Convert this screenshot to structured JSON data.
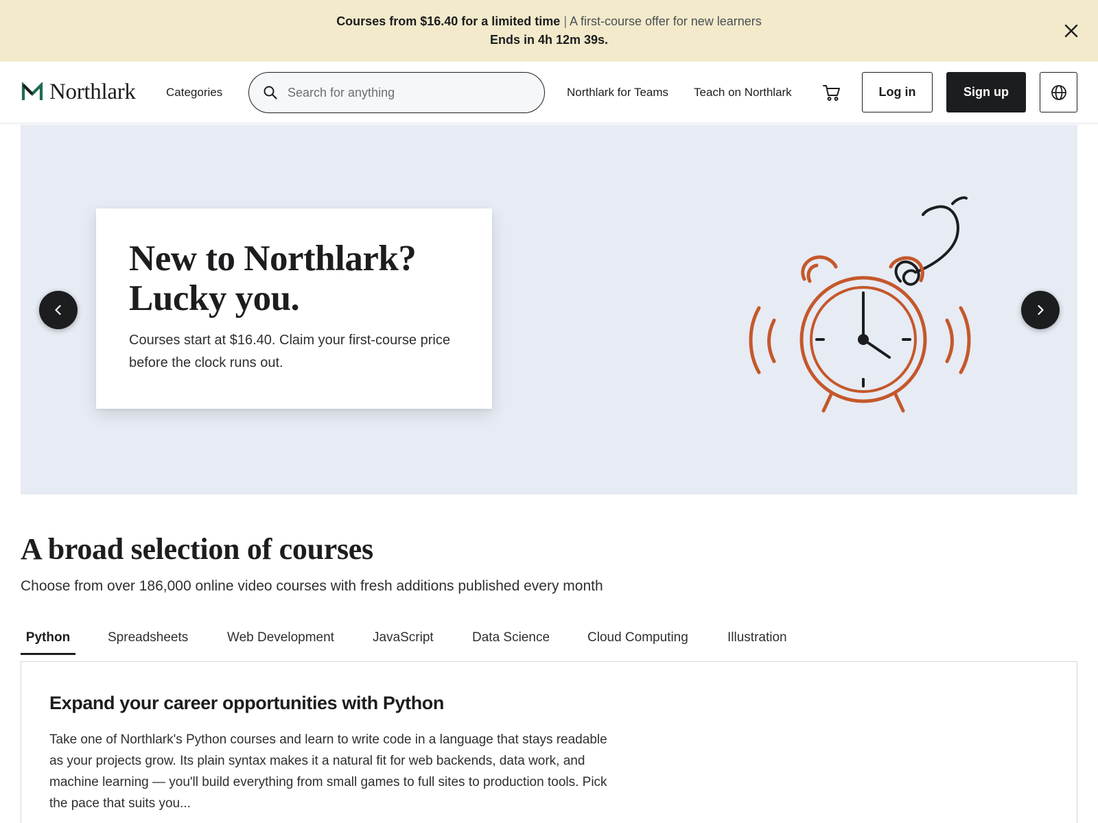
{
  "promo": {
    "headline": "Courses from $16.40 for a limited time",
    "separator": "|",
    "subtext": "A first-course offer for new learners",
    "countdown": "Ends in 4h 12m 39s.",
    "close_icon": "close-icon"
  },
  "header": {
    "logo_text": "Northlark",
    "categories_label": "Categories",
    "search": {
      "placeholder": "Search for anything",
      "value": ""
    },
    "teams_label": "Northlark for Teams",
    "teach_label": "Teach on Northlark",
    "cart_icon": "cart-icon",
    "login_label": "Log in",
    "signup_label": "Sign up",
    "language_icon": "globe-icon"
  },
  "hero": {
    "title_line1": "New to Northlark?",
    "title_line2": "Lucky you.",
    "text": "Courses start at $16.40. Claim your first-course price before the clock runs out.",
    "prev_icon": "chevron-left-icon",
    "next_icon": "chevron-right-icon",
    "illustration": "alarm-clock-illustration",
    "accent_color": "#c4582b",
    "background_color": "#e7ebf4"
  },
  "courses_section": {
    "title": "A broad selection of courses",
    "subtitle": "Choose from over 186,000 online video courses with fresh additions published every month",
    "tabs": [
      {
        "label": "Python",
        "active": true
      },
      {
        "label": "Spreadsheets",
        "active": false
      },
      {
        "label": "Web Development",
        "active": false
      },
      {
        "label": "JavaScript",
        "active": false
      },
      {
        "label": "Data Science",
        "active": false
      },
      {
        "label": "Cloud Computing",
        "active": false
      },
      {
        "label": "Illustration",
        "active": false
      }
    ],
    "panel": {
      "title": "Expand your career opportunities with Python",
      "text": "Take one of Northlark's Python courses and learn to write code in a language that stays readable as your projects grow. Its plain syntax makes it a natural fit for web backends, data work, and machine learning — you'll build everything from small games to full sites to production tools. Pick the pace that suits you..."
    }
  },
  "colors": {
    "promo_bg": "#f2eacb",
    "logo_green": "#1f6b52",
    "primary_dark": "#1c1d1f"
  }
}
